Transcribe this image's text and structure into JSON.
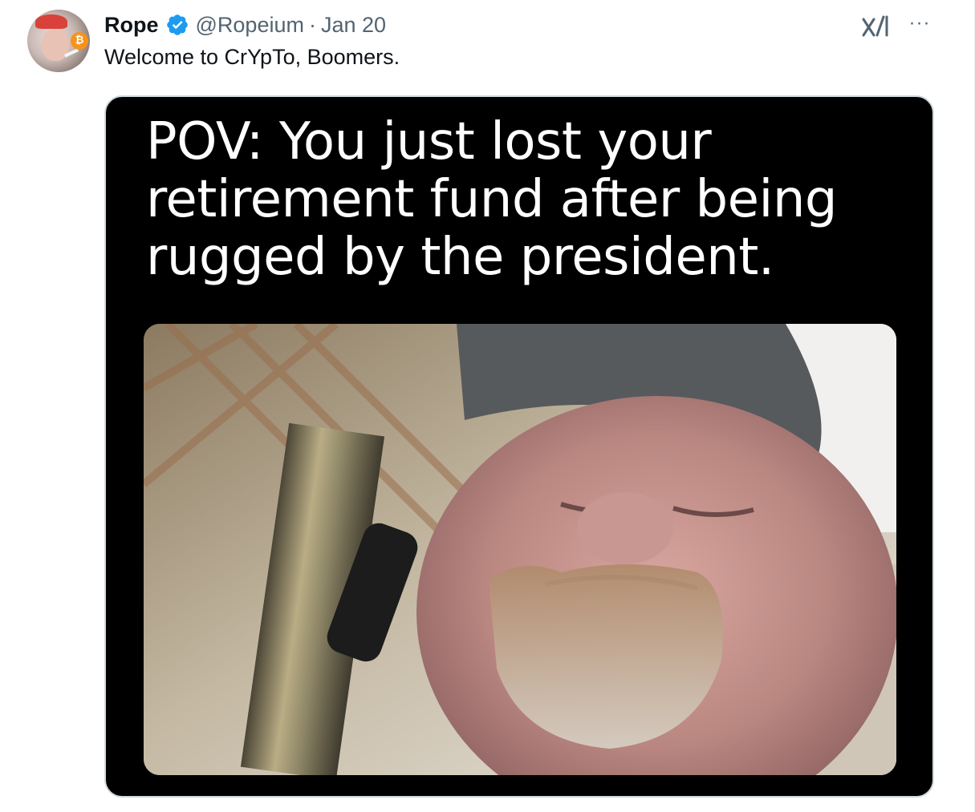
{
  "tweet": {
    "author_name": "Rope",
    "handle": "@Ropeium",
    "separator": "·",
    "date": "Jan 20",
    "text": "Welcome to CrYpTo, Boomers.",
    "more_label": "···"
  },
  "media": {
    "caption": "POV: You just lost your retirement fund after being rugged by the president."
  },
  "icons": {
    "verified": "verified-badge-icon",
    "grok": "grok-icon",
    "more": "more-options-icon"
  },
  "colors": {
    "verified_blue": "#1d9bf0",
    "text_primary": "#0f1419",
    "text_secondary": "#536471",
    "border": "#cfd9de",
    "bitcoin_orange": "#f7931a"
  }
}
